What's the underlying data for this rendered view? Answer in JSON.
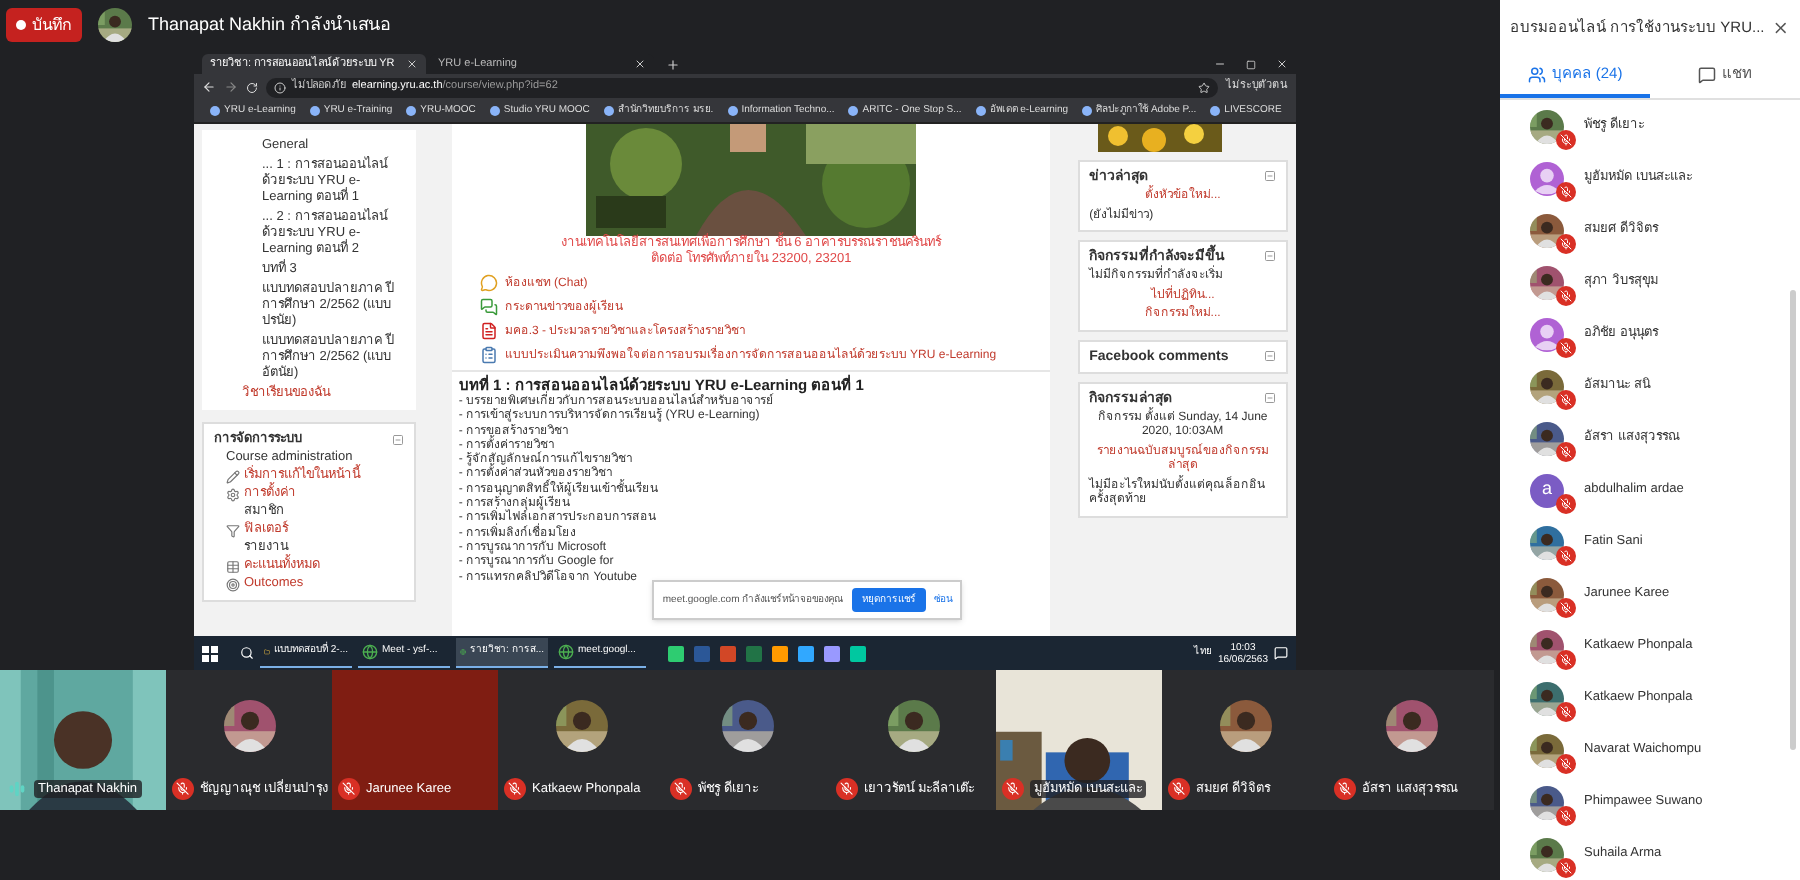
{
  "recording_badge": "บันทึก",
  "presenter": "Thanapat Nakhin กำลังนำเสนอ",
  "shared_screen": {
    "browser_tabs": [
      {
        "title": "รายวิชา: การสอนออนไลน์ด้วยระบบ YR",
        "selected": true
      },
      {
        "title": "YRU e-Learning",
        "selected": false
      }
    ],
    "address_bar": {
      "security": "ไม่ปลอดภัย",
      "host": "elearning.yru.ac.th",
      "path": "/course/view.php?id=62"
    },
    "profile": "ไม่ระบุตัวตน",
    "bookmarks": [
      "YRU e-Learning",
      "YRU e-Training",
      "YRU-MOOC",
      "Studio YRU MOOC",
      "สำนักวิทยบริการ มรย.",
      "Information Techno...",
      "ARITC - One Stop S...",
      "อัพเดต e-Learning",
      "ศิลปะภูกาใช้ Adobe P...",
      "LIVESCORE"
    ],
    "left_nav": {
      "items": [
        "General",
        "... 1 : การสอนออนไลน์ด้วยระบบ YRU e-Learning ตอนที่ 1",
        "... 2 : การสอนออนไลน์ด้วยระบบ YRU e-Learning ตอนที่ 2",
        "บทที่ 3",
        "แบบทดสอบปลายภาค ปีการศึกษา 2/2562 (แบบปรนัย)",
        "แบบทดสอบปลายภาค ปีการศึกษา 2/2562 (แบบอัตนัย)"
      ],
      "my_courses_link": "วิชาเรียนของฉัน",
      "admin": {
        "title": "การจัดการระบบ",
        "heading": "Course administration",
        "items": [
          {
            "label": "เริ่มการแก้ไขในหน้านี้",
            "kind": "edit"
          },
          {
            "label": "การตั้งค่า",
            "kind": "settings"
          },
          {
            "label": "สมาชิก",
            "kind": "plain"
          },
          {
            "label": "ฟิลเตอร์",
            "kind": "filter"
          },
          {
            "label": "รายงาน",
            "kind": "plain"
          },
          {
            "label": "คะแนนทั้งหมด",
            "kind": "grades"
          },
          {
            "label": "Outcomes",
            "kind": "outcomes"
          }
        ]
      }
    },
    "center": {
      "address_lines": [
        "งานเทคโนโลยีสารสนเทศเพื่อการศึกษา ชั้น 6 อาคารบรรณราชนครินทร์",
        "ติดต่อ โทรศัพท์ภายใน 23200, 23201"
      ],
      "resources": [
        {
          "label": "ห้องแชท (Chat)",
          "kind": "chat"
        },
        {
          "label": "กระดานข่าวของผู้เรียน",
          "kind": "forum"
        },
        {
          "label": "มคอ.3 - ประมวลรายวิชาและโครงสร้างรายวิชา",
          "kind": "pdf"
        },
        {
          "label": "แบบประเมินความพึงพอใจต่อการอบรมเรื่องการจัดการสอนออนไลน์ด้วยระบบ YRU e-Learning",
          "kind": "feedback"
        }
      ],
      "section_title": "บทที่ 1 : การสอนออนไลน์ด้วยระบบ YRU e-Learning ตอนที่ 1",
      "topics": [
        "- บรรยายพิเศษเกี่ยวกับการสอนระบบออนไลน์สำหรับอาจารย์",
        "- การเข้าสู่ระบบการบริหารจัดการเรียนรู้ (YRU e-Learning)",
        "- การขอสร้างรายวิชา",
        "- การตั้งค่ารายวิชา",
        "- รู้จักสัญลักษณ์การแก้ไขรายวิชา",
        "- การตั้งค่าส่วนหัวของรายวิชา",
        "- การอนุญาตสิทธิ์ให้ผู้เรียนเข้าชั้นเรียน",
        "- การสร้างกลุ่มผู้เรียน",
        "- การเพิ่มไฟล์เอกสารประกอบการสอน",
        "- การเพิ่มลิงก์เชื่อมโยง",
        "- การบูรณาการกับ Microsoft",
        "- การบูรณาการกับ Google for",
        "- การแทรกคลิปวิดีโอจาก Youtube"
      ]
    },
    "right_blocks": [
      {
        "title": "ข่าวล่าสุด",
        "lines": [
          {
            "text": "ตั้งหัวข้อใหม่...",
            "kind": "link"
          },
          {
            "text": "(ยังไม่มีข่าว)",
            "kind": "plain"
          }
        ]
      },
      {
        "title": "กิจกรรมที่กำลังจะมีขึ้น",
        "lines": [
          {
            "text": "ไม่มีกิจกรรมที่กำลังจะเริ่ม",
            "kind": "plain"
          },
          {
            "text": "ไปที่ปฏิทิน...",
            "kind": "link"
          },
          {
            "text": "กิจกรรมใหม่...",
            "kind": "link"
          }
        ]
      },
      {
        "title": "Facebook comments"
      },
      {
        "title": "กิจกรรมล่าสุด",
        "lines": [
          {
            "text": "กิจกรรม ตั้งแต่ Sunday, 14 June 2020, 10:03AM",
            "kind": "center"
          },
          {
            "text": "รายงานฉบับสมบูรณ์ของกิจกรรมล่าสุด",
            "kind": "link"
          },
          {
            "text": "ไม่มีอะไรใหม่นับตั้งแต่คุณล็อกอินครั้งสุดท้าย",
            "kind": "plain"
          }
        ]
      }
    ],
    "share_notice": {
      "text": "meet.google.com กำลังแชร์หน้าจอของคุณ",
      "stop_button": "หยุดการแชร์",
      "hide_link": "ซ่อน"
    },
    "taskbar": {
      "windows": [
        {
          "label": "แบบทดสอบที่ 2-...",
          "kind": "folder",
          "selected": false
        },
        {
          "label": "Meet - ysf-...",
          "kind": "chrome",
          "selected": false
        },
        {
          "label": "รายวิชา: การส...",
          "kind": "chrome",
          "selected": true
        },
        {
          "label": "meet.googl...",
          "kind": "chrome",
          "selected": false
        }
      ],
      "language": "ไทย",
      "time": "10:03",
      "date": "16/06/2563"
    }
  },
  "tiles": [
    {
      "name": "Thanapat Nakhin",
      "kind": "video",
      "muted": false
    },
    {
      "name": "ชัญญาณุช เปลี่ยนปารุง",
      "kind": "avatar",
      "muted": true
    },
    {
      "name": "Jarunee Karee",
      "kind": "solid",
      "color": "#7f1d12",
      "muted": true
    },
    {
      "name": "Katkaew Phonpala",
      "kind": "avatar",
      "muted": true
    },
    {
      "name": "พัชรู ดีเยาะ",
      "kind": "avatar",
      "muted": true
    },
    {
      "name": "เยาวรัตน์ มะลีลาเต๊ะ",
      "kind": "avatar",
      "muted": true
    },
    {
      "name": "มูฮัมหมัด เบนสะและ",
      "kind": "video",
      "muted": true
    },
    {
      "name": "สมยศ ดีวิจิตร",
      "kind": "avatar",
      "muted": true
    },
    {
      "name": "อัสรา แสงสุวรรณ",
      "kind": "avatar",
      "muted": true
    }
  ],
  "panel": {
    "title": "อบรมออนไลน์ การใช้งานระบบ YRU...",
    "tabs": [
      {
        "label": "บุคคล (24)",
        "kind": "people",
        "selected": true
      },
      {
        "label": "แชท",
        "kind": "chat",
        "selected": false
      }
    ],
    "people": [
      {
        "name": "พัชรู ดีเยาะ",
        "muted": true
      },
      {
        "name": "มูฮัมหมัด เบนสะและ",
        "kind": "silhouette",
        "muted": true
      },
      {
        "name": "สมยศ ดีวิจิตร",
        "muted": true
      },
      {
        "name": "สุภา วิบรสุขุม",
        "muted": true
      },
      {
        "name": "อภิชัย อนุนุตร",
        "kind": "silhouette",
        "muted": true
      },
      {
        "name": "อัสมานะ สนิ",
        "muted": true
      },
      {
        "name": "อัสรา แสงสุวรรณ",
        "muted": true
      },
      {
        "name": "abdulhalim ardae",
        "kind": "letter",
        "letter": "a",
        "muted": true
      },
      {
        "name": "Fatin Sani",
        "muted": true
      },
      {
        "name": "Jarunee Karee",
        "muted": true
      },
      {
        "name": "Katkaew Phonpala",
        "muted": true
      },
      {
        "name": "Katkaew Phonpala",
        "muted": true
      },
      {
        "name": "Navarat Waichompu",
        "muted": true
      },
      {
        "name": "Phimpawee Suwano",
        "muted": true
      },
      {
        "name": "Suhaila Arma",
        "muted": true
      }
    ]
  }
}
